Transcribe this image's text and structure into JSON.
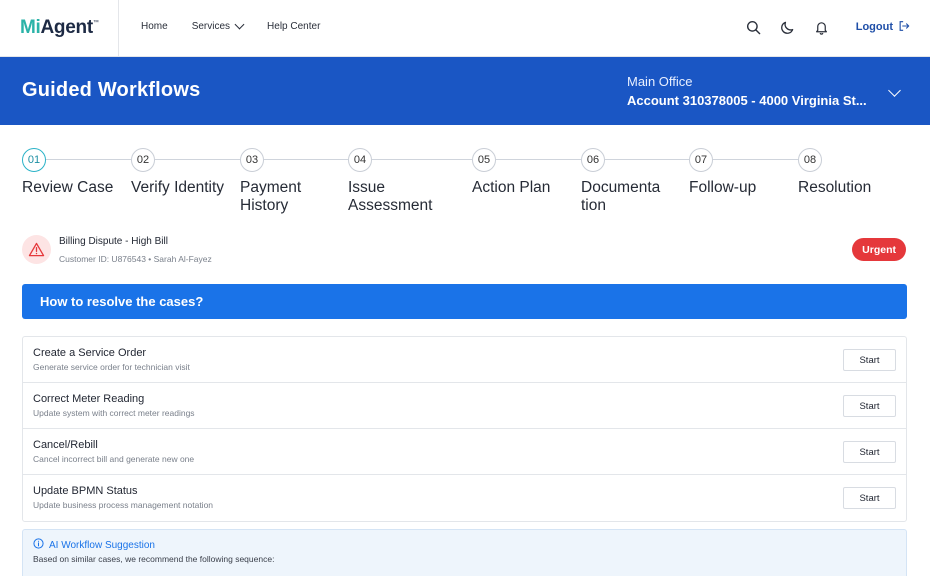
{
  "nav": {
    "logo_prefix": "Mi",
    "logo_text": "Agent",
    "logo_tm": "™",
    "items": [
      "Home",
      "Services",
      "Help Center"
    ],
    "logout_label": "Logout"
  },
  "banner": {
    "title": "Guided Workflows",
    "account_office": "Main Office",
    "account_number": "Account 310378005 - 4000 Virginia St..."
  },
  "steps": [
    {
      "num": "01",
      "label": "Review Case"
    },
    {
      "num": "02",
      "label": "Verify Identity"
    },
    {
      "num": "03",
      "label": "Payment History"
    },
    {
      "num": "04",
      "label": "Issue Assessment"
    },
    {
      "num": "05",
      "label": "Action Plan"
    },
    {
      "num": "06",
      "label": "Documenta tion"
    },
    {
      "num": "07",
      "label": "Follow-up"
    },
    {
      "num": "08",
      "label": "Resolution"
    }
  ],
  "case": {
    "title": "Billing Dispute - High Bill",
    "subtitle": "Customer ID: U876543 • Sarah Al-Fayez",
    "priority": "Urgent"
  },
  "howto_title": "How to resolve the cases?",
  "actions": [
    {
      "title": "Create a Service Order",
      "desc": "Generate service order for technician visit",
      "button": "Start"
    },
    {
      "title": "Correct Meter Reading",
      "desc": "Update system with correct meter readings",
      "button": "Start"
    },
    {
      "title": "Cancel/Rebill",
      "desc": "Cancel incorrect bill and generate new one",
      "button": "Start"
    },
    {
      "title": "Update BPMN Status",
      "desc": "Update business process management notation",
      "button": "Start"
    }
  ],
  "ai": {
    "title": "AI Workflow Suggestion",
    "desc": "Based on similar cases, we recommend the following sequence:"
  },
  "colors": {
    "brand_blue": "#1a56c4",
    "accent_blue": "#1a73e8",
    "teal": "#2bb3c8",
    "urgent_red": "#e5383b"
  },
  "icons": [
    "search-icon",
    "moon-icon",
    "bell-icon",
    "logout-icon",
    "chevron-down-icon",
    "warning-icon",
    "info-icon"
  ]
}
